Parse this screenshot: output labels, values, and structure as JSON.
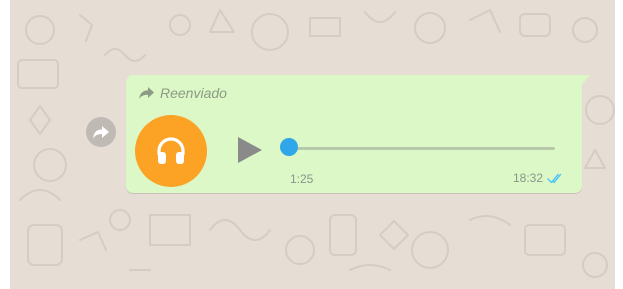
{
  "message": {
    "forwarded_label": "Reenviado",
    "duration": "1:25",
    "time": "18:32",
    "progress": 0.0,
    "status": "read"
  },
  "icons": {
    "forward": "forward-arrow-icon",
    "forwarded": "forwarded-arrow-icon",
    "avatar": "headphones-icon",
    "play": "play-icon",
    "ticks": "double-check-icon"
  },
  "colors": {
    "chat_background": "#e6ddd4",
    "bubble": "#dcf8c6",
    "avatar": "#fca325",
    "progress_accent": "#2fa7e8",
    "read_ticks": "#4fc3f7",
    "meta_text": "#88978a"
  }
}
